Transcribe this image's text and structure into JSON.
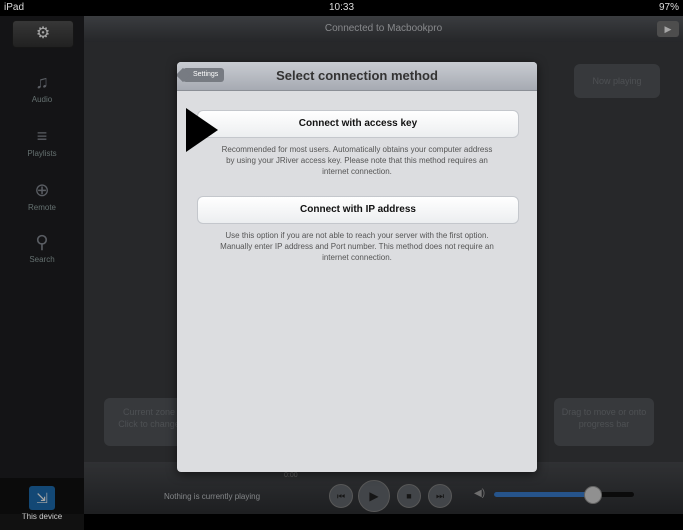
{
  "status": {
    "device": "iPad",
    "time": "10:33",
    "battery": "97%"
  },
  "topbar": {
    "title": "Connected to Macbookpro"
  },
  "sidebar": {
    "items": [
      {
        "label": "Audio"
      },
      {
        "label": "Playlists"
      },
      {
        "label": "Remote"
      },
      {
        "label": "Search"
      }
    ],
    "device_label": "This device"
  },
  "main": {
    "now_playing_bubble": "Now playing",
    "left_bubble": "Current zone\nClick to change",
    "right_bubble": "Drag to move or onto\nprogress bar"
  },
  "dialog": {
    "back_label": "Settings",
    "title": "Select connection method",
    "option1": "Connect with access key",
    "option1_desc": "Recommended for most users. Automatically obtains your computer address by using your JRiver access key. Please note that this method requires an internet connection.",
    "option2": "Connect with IP address",
    "option2_desc": "Use this option if you are not able to reach your server with the first option. Manually enter IP address and Port number. This method does not require an internet connection."
  },
  "player": {
    "now_text": "Nothing is currently playing",
    "elapsed": "0:00",
    "volume": 0.7
  }
}
